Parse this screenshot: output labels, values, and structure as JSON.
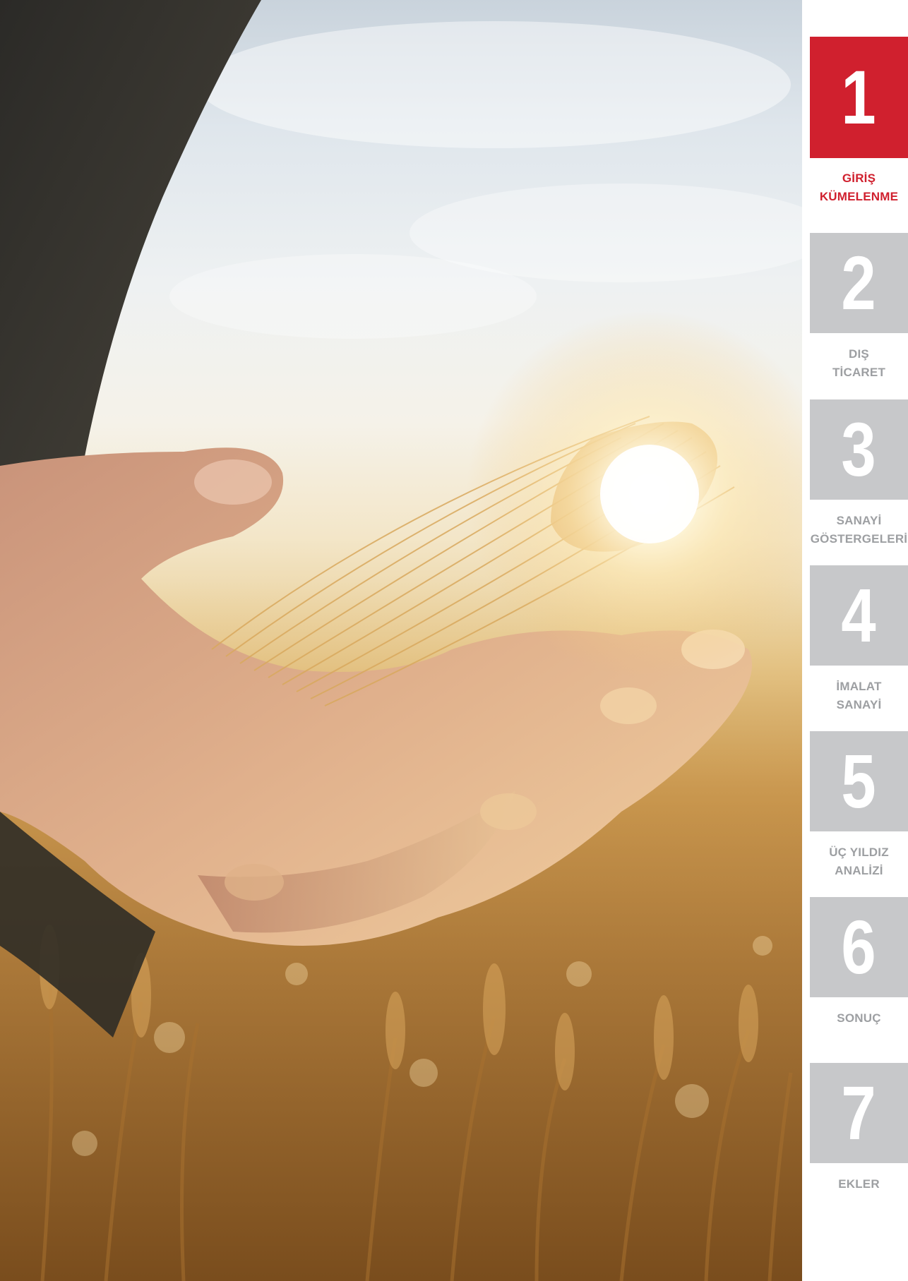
{
  "sidebar": {
    "chapters": [
      {
        "number": "1",
        "label_line1": "GİRİŞ",
        "label_line2": "KÜMELENME",
        "active": true
      },
      {
        "number": "2",
        "label_line1": "DIŞ",
        "label_line2": "TİCARET",
        "active": false
      },
      {
        "number": "3",
        "label_line1": "SANAYİ",
        "label_line2": "GÖSTERGELERİ",
        "active": false
      },
      {
        "number": "4",
        "label_line1": "İMALAT",
        "label_line2": "SANAYİ",
        "active": false
      },
      {
        "number": "5",
        "label_line1": "ÜÇ YILDIZ",
        "label_line2": "ANALİZİ",
        "active": false
      },
      {
        "number": "6",
        "label_line1": "SONUÇ",
        "label_line2": "",
        "active": false
      },
      {
        "number": "7",
        "label_line1": "EKLER",
        "label_line2": "",
        "active": false
      }
    ]
  },
  "colors": {
    "active": "#d0202e",
    "inactive_box": "#c7c8ca",
    "inactive_label": "#9d9fa2"
  }
}
